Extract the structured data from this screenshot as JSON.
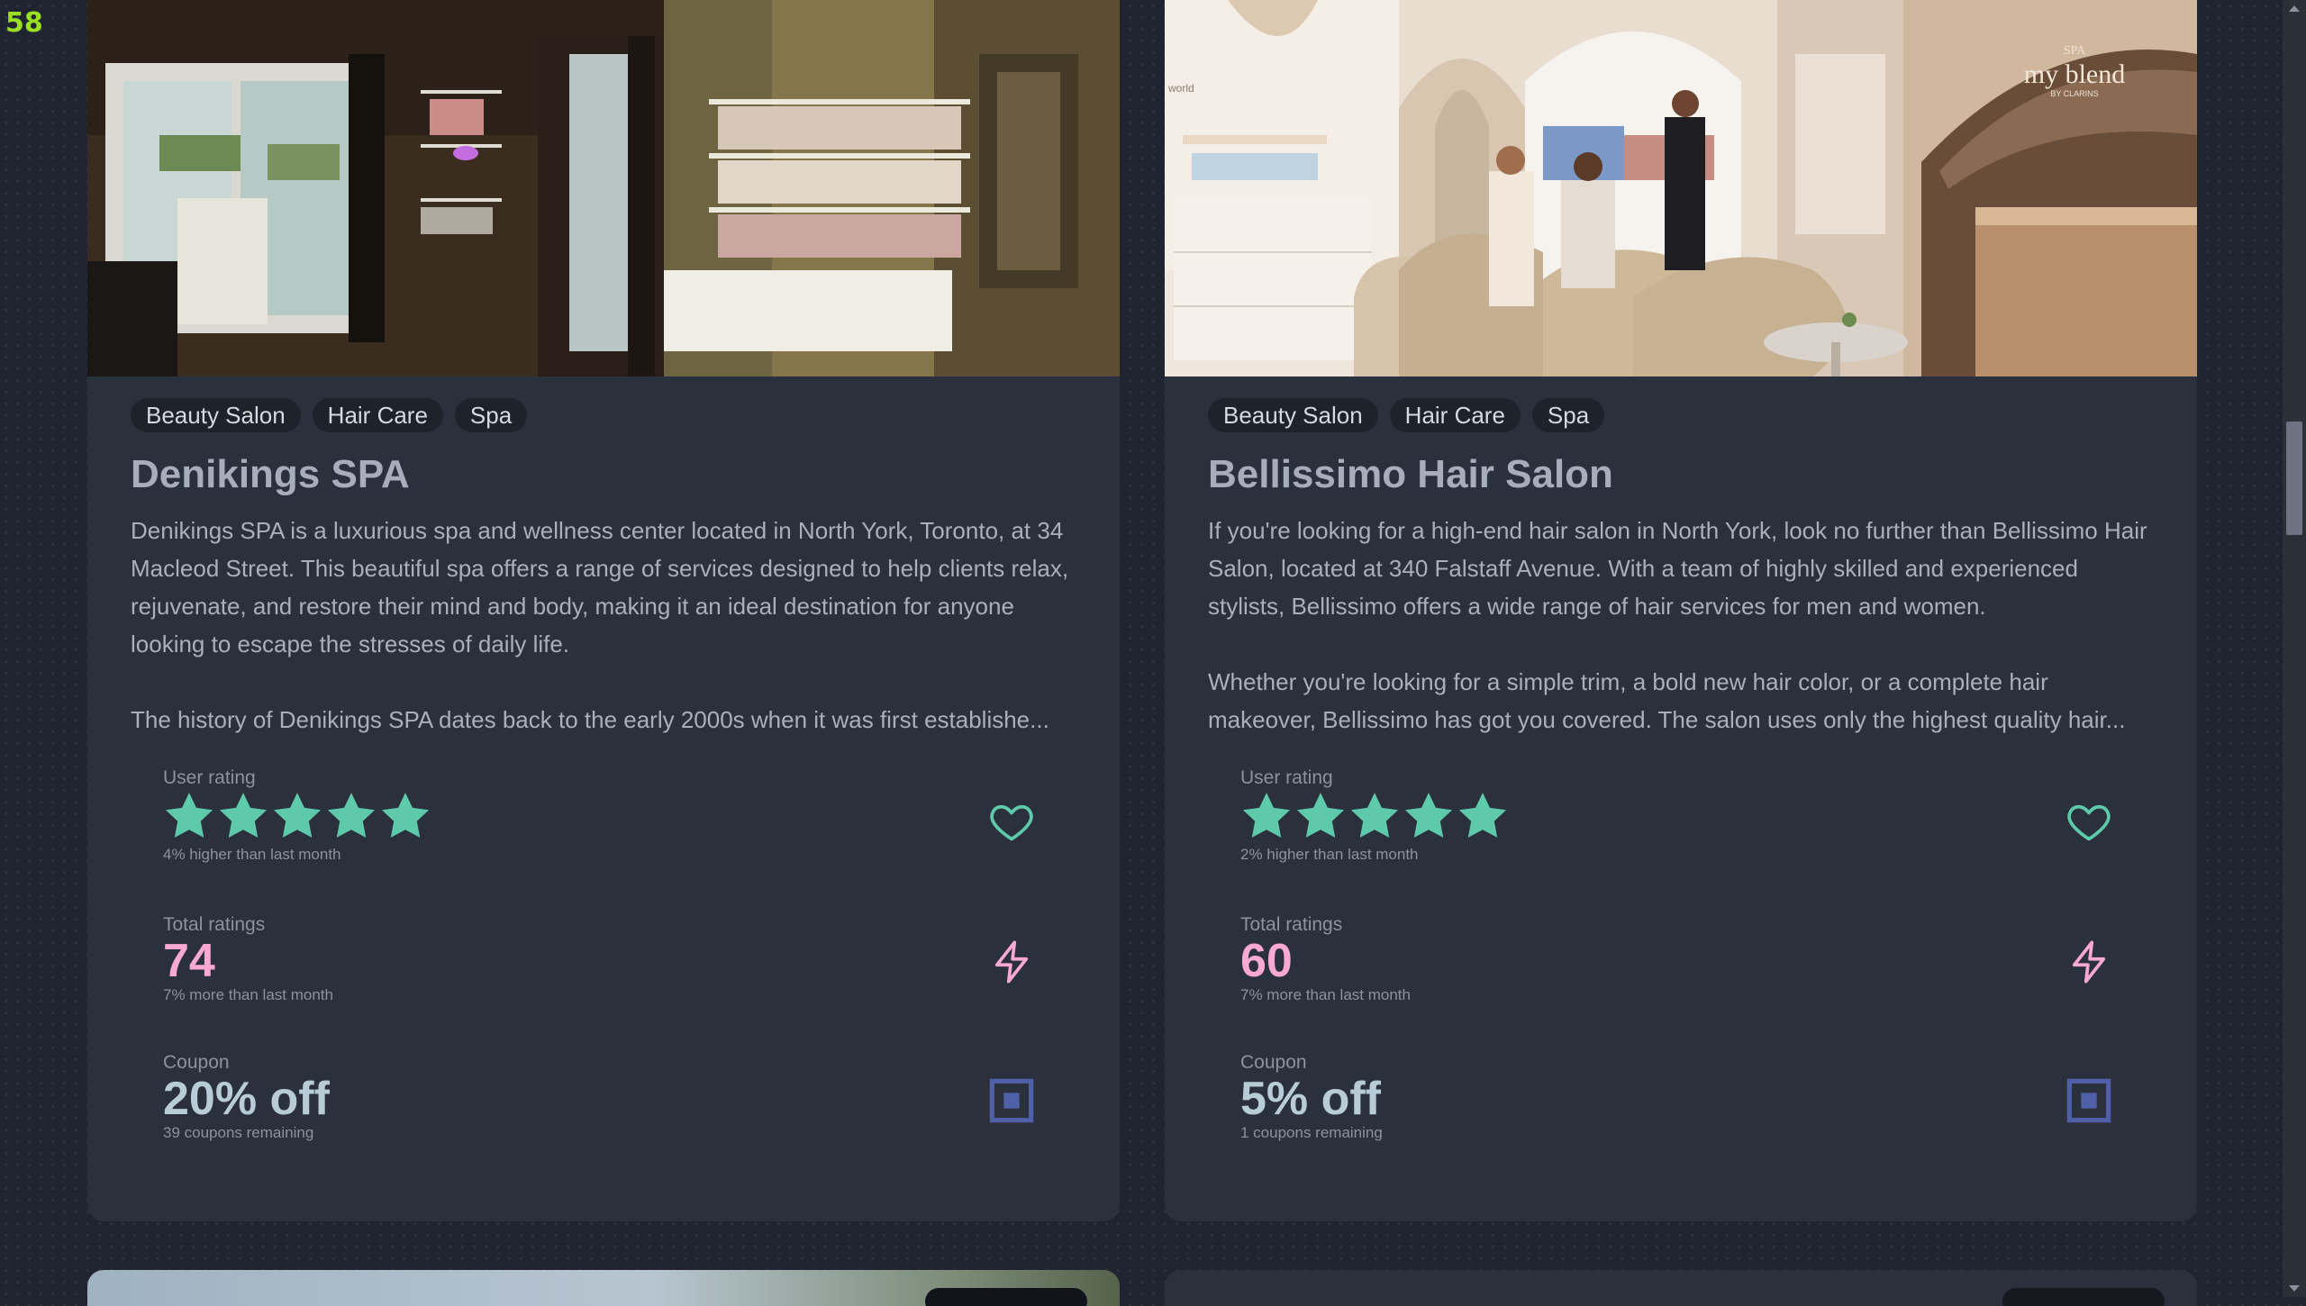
{
  "fps_counter": "58",
  "cards": [
    {
      "tags": [
        "Beauty Salon",
        "Hair Care",
        "Spa"
      ],
      "title": "Denikings SPA",
      "description_1": "Denikings SPA is a luxurious spa and wellness center located in North York, Toronto, at 34 Macleod Street. This beautiful spa offers a range of services designed to help clients relax, rejuvenate, and restore their mind and body, making it an ideal destination for anyone looking to escape the stresses of daily life.",
      "description_2": "The history of Denikings SPA dates back to the early 2000s when it was first establishe...",
      "rating": {
        "label": "User rating",
        "stars": 5,
        "note": "4% higher than last month"
      },
      "total": {
        "label": "Total ratings",
        "value": "74",
        "note": "7% more than last month"
      },
      "coupon": {
        "label": "Coupon",
        "value": "20% off",
        "note": "39 coupons remaining"
      }
    },
    {
      "tags": [
        "Beauty Salon",
        "Hair Care",
        "Spa"
      ],
      "title": "Bellissimo Hair Salon",
      "description_1": "If you're looking for a high-end hair salon in North York, look no further than Bellissimo Hair Salon, located at 340 Falstaff Avenue. With a team of highly skilled and experienced stylists, Bellissimo offers a wide range of hair services for men and women.",
      "description_2": "Whether you're looking for a simple trim, a bold new hair color, or a complete hair makeover, Bellissimo has got you covered. The salon uses only the highest quality hair...",
      "rating": {
        "label": "User rating",
        "stars": 5,
        "note": "2% higher than last month"
      },
      "total": {
        "label": "Total ratings",
        "value": "60",
        "note": "7% more than last month"
      },
      "coupon": {
        "label": "Coupon",
        "value": "5% off",
        "note": "1 coupons remaining"
      }
    }
  ],
  "photo_signage": {
    "brand": "my blend",
    "small_top": "SPA",
    "small_bottom": "BY CLARINS",
    "wall_text": "world"
  },
  "icons": {
    "favorite": "heart-icon",
    "boost": "lightning-icon",
    "coupon": "square-ticket-icon"
  },
  "colors": {
    "star": "#5fc9ab",
    "total_value": "#f9a9d4",
    "coupon_value": "#b8ccd8",
    "coupon_icon": "#4f5fa8"
  }
}
